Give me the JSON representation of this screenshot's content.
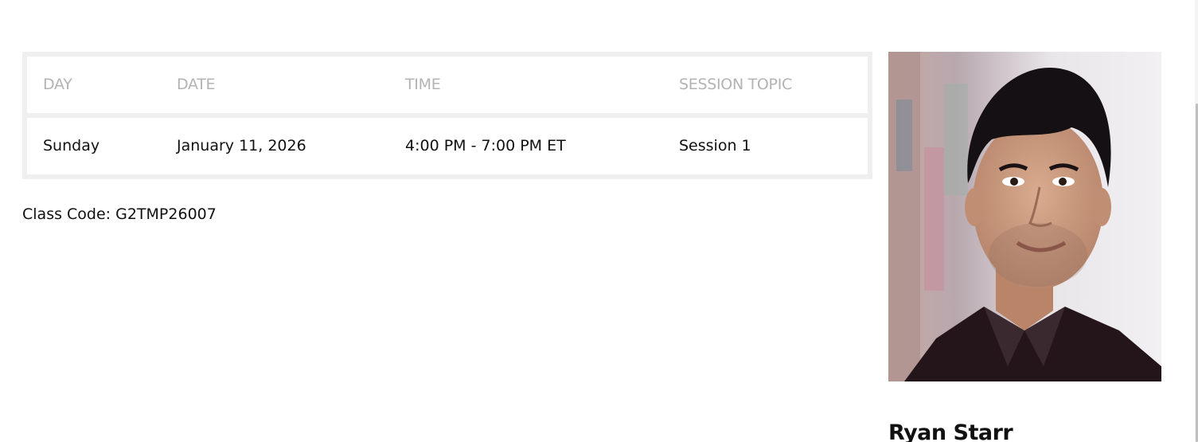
{
  "schedule": {
    "headers": {
      "day": "DAY",
      "date": "DATE",
      "time": "TIME",
      "topic": "SESSION TOPIC"
    },
    "rows": [
      {
        "day": "Sunday",
        "date": "January 11, 2026",
        "time": "4:00 PM - 7:00 PM ET",
        "topic": "Session 1"
      }
    ]
  },
  "class_code": {
    "label": "Class Code:",
    "value": "G2TMP26007"
  },
  "instructor": {
    "name": "Ryan Starr",
    "photo_icon": "instructor-portrait"
  },
  "colors": {
    "table_border": "#efefef",
    "header_text": "#b3b3b3",
    "body_text": "#111111"
  }
}
